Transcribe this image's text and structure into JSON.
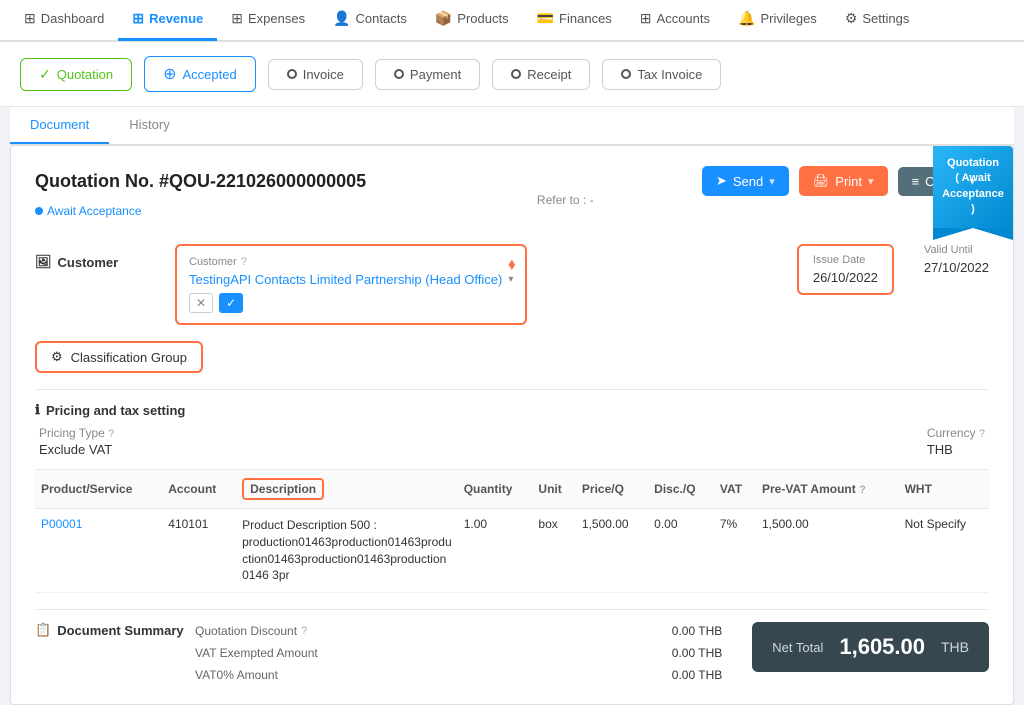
{
  "nav": {
    "items": [
      {
        "label": "Dashboard",
        "icon": "⊞",
        "active": false
      },
      {
        "label": "Revenue",
        "icon": "⊞",
        "active": true
      },
      {
        "label": "Expenses",
        "icon": "⊞",
        "active": false
      },
      {
        "label": "Contacts",
        "icon": "👤",
        "active": false
      },
      {
        "label": "Products",
        "icon": "📦",
        "active": false
      },
      {
        "label": "Finances",
        "icon": "💳",
        "active": false
      },
      {
        "label": "Accounts",
        "icon": "⊞",
        "active": false
      },
      {
        "label": "Privileges",
        "icon": "🔔",
        "active": false
      },
      {
        "label": "Settings",
        "icon": "⚙",
        "active": false
      }
    ]
  },
  "status_steps": [
    {
      "label": "Quotation",
      "icon": "check",
      "state": "active-green"
    },
    {
      "label": "Accepted",
      "icon": "plus",
      "state": "active-blue"
    },
    {
      "label": "Invoice",
      "icon": "radio",
      "state": ""
    },
    {
      "label": "Payment",
      "icon": "radio",
      "state": ""
    },
    {
      "label": "Receipt",
      "icon": "radio",
      "state": ""
    },
    {
      "label": "Tax Invoice",
      "icon": "radio",
      "state": ""
    }
  ],
  "tabs": [
    {
      "label": "Document",
      "active": true
    },
    {
      "label": "History",
      "active": false
    }
  ],
  "document": {
    "quotation_no": "Quotation No. #QOU-221026000000005",
    "status_tag": "Await Acceptance",
    "refer_label": "Refer to :",
    "refer_value": "-",
    "buttons": {
      "send": "Send",
      "print": "Print",
      "option": "Option"
    },
    "ribbon": {
      "line1": "Quotation",
      "line2": "( Await",
      "line3": "Acceptance )"
    }
  },
  "customer_section": {
    "label": "Customer",
    "field_label": "Customer",
    "field_value": "TestingAPI Contacts Limited Partnership (Head Office)",
    "tooltip": "?"
  },
  "dates": {
    "issue_date_label": "Issue Date",
    "issue_date_value": "26/10/2022",
    "valid_until_label": "Valid Until",
    "valid_until_value": "27/10/2022"
  },
  "classification": {
    "label": "Classification Group"
  },
  "pricing": {
    "section_label": "Pricing and tax setting",
    "pricing_type_label": "Pricing Type",
    "pricing_type_value": "Exclude VAT",
    "currency_label": "Currency",
    "currency_value": "THB"
  },
  "table": {
    "headers": [
      {
        "label": "Product/Service",
        "key": "product"
      },
      {
        "label": "Account",
        "key": "account"
      },
      {
        "label": "Description",
        "key": "description",
        "highlighted": true
      },
      {
        "label": "Quantity",
        "key": "quantity"
      },
      {
        "label": "Unit",
        "key": "unit"
      },
      {
        "label": "Price/Q",
        "key": "price"
      },
      {
        "label": "Disc./Q",
        "key": "disc"
      },
      {
        "label": "VAT",
        "key": "vat"
      },
      {
        "label": "Pre-VAT Amount",
        "key": "pre_vat",
        "tooltip": true
      },
      {
        "label": "WHT",
        "key": "wht"
      }
    ],
    "rows": [
      {
        "product": "P00001",
        "account": "410101",
        "description": "Product Description 500 : production01463production01463production01463production01463production0146 3pr",
        "quantity": "1.00",
        "unit": "box",
        "price": "1,500.00",
        "disc": "0.00",
        "vat": "7%",
        "pre_vat": "1,500.00",
        "wht": "Not Specify"
      }
    ]
  },
  "summary": {
    "title": "Document Summary",
    "rows": [
      {
        "label": "Quotation Discount",
        "value": "0.00 THB",
        "tooltip": true
      },
      {
        "label": "VAT Exempted Amount",
        "value": "0.00 THB",
        "tooltip": false
      },
      {
        "label": "VAT0% Amount",
        "value": "0.00 THB",
        "tooltip": false
      }
    ],
    "net_total_label": "Net Total",
    "net_total_value": "1,605.00",
    "net_total_currency": "THB"
  }
}
